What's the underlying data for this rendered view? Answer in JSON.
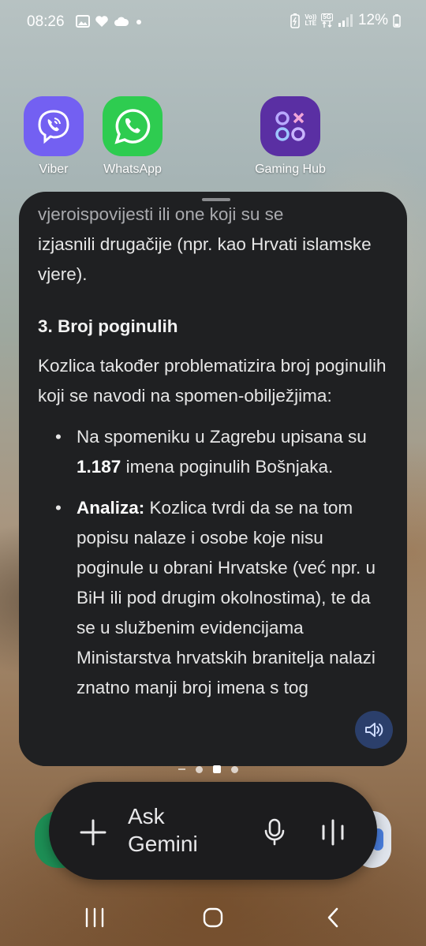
{
  "status_bar": {
    "time": "08:26",
    "battery": "12%",
    "volte_top": "Vo))",
    "volte_bottom": "LTE",
    "network": "5G"
  },
  "apps": [
    {
      "label": "Viber",
      "icon": "viber-icon",
      "color": "#7360f2"
    },
    {
      "label": "WhatsApp",
      "icon": "whatsapp-icon",
      "color": "#2ecc50"
    },
    {
      "label": "Gaming Hub",
      "icon": "gaming-hub-icon",
      "color": "#5a2fa3"
    }
  ],
  "gemini_panel": {
    "top_text_1": "vjeroispovijesti ili one koji su se",
    "top_text_2": "izjasnili drugačije (npr. kao Hrvati islamske vjere).",
    "heading": "3. Broj poginulih",
    "intro": "Kozlica također problematizira broj poginulih koji se navodi na spomen-obilježjima:",
    "bullet_1_pre": "Na spomeniku u Zagrebu upisana su ",
    "bullet_1_bold": "1.187",
    "bullet_1_post": " imena poginulih Bošnjaka.",
    "bullet_2_bold": "Analiza:",
    "bullet_2_text": " Kozlica tvrdi da se na tom popisu nalaze i osobe koje nisu poginule u obrani Hrvatske (već npr. u BiH ili pod drugim okolnostima), te da se u službenim evidencijama Ministarstva hrvatskih branitelja nalazi znatno manji broj imena s tog",
    "speaker_icon": "speaker-icon"
  },
  "ask_bar": {
    "placeholder_line_1": "Ask",
    "placeholder_line_2": "Gemini",
    "plus_icon": "plus-icon",
    "mic_icon": "mic-icon",
    "live_icon": "live-waveform-icon"
  },
  "nav": {
    "recent": "recent-apps-icon",
    "home": "home-icon",
    "back": "back-icon"
  },
  "colors": {
    "panel_bg": "#1f2022",
    "bar_bg": "#1c1c1e",
    "speaker_bg": "#2b3f6b"
  }
}
